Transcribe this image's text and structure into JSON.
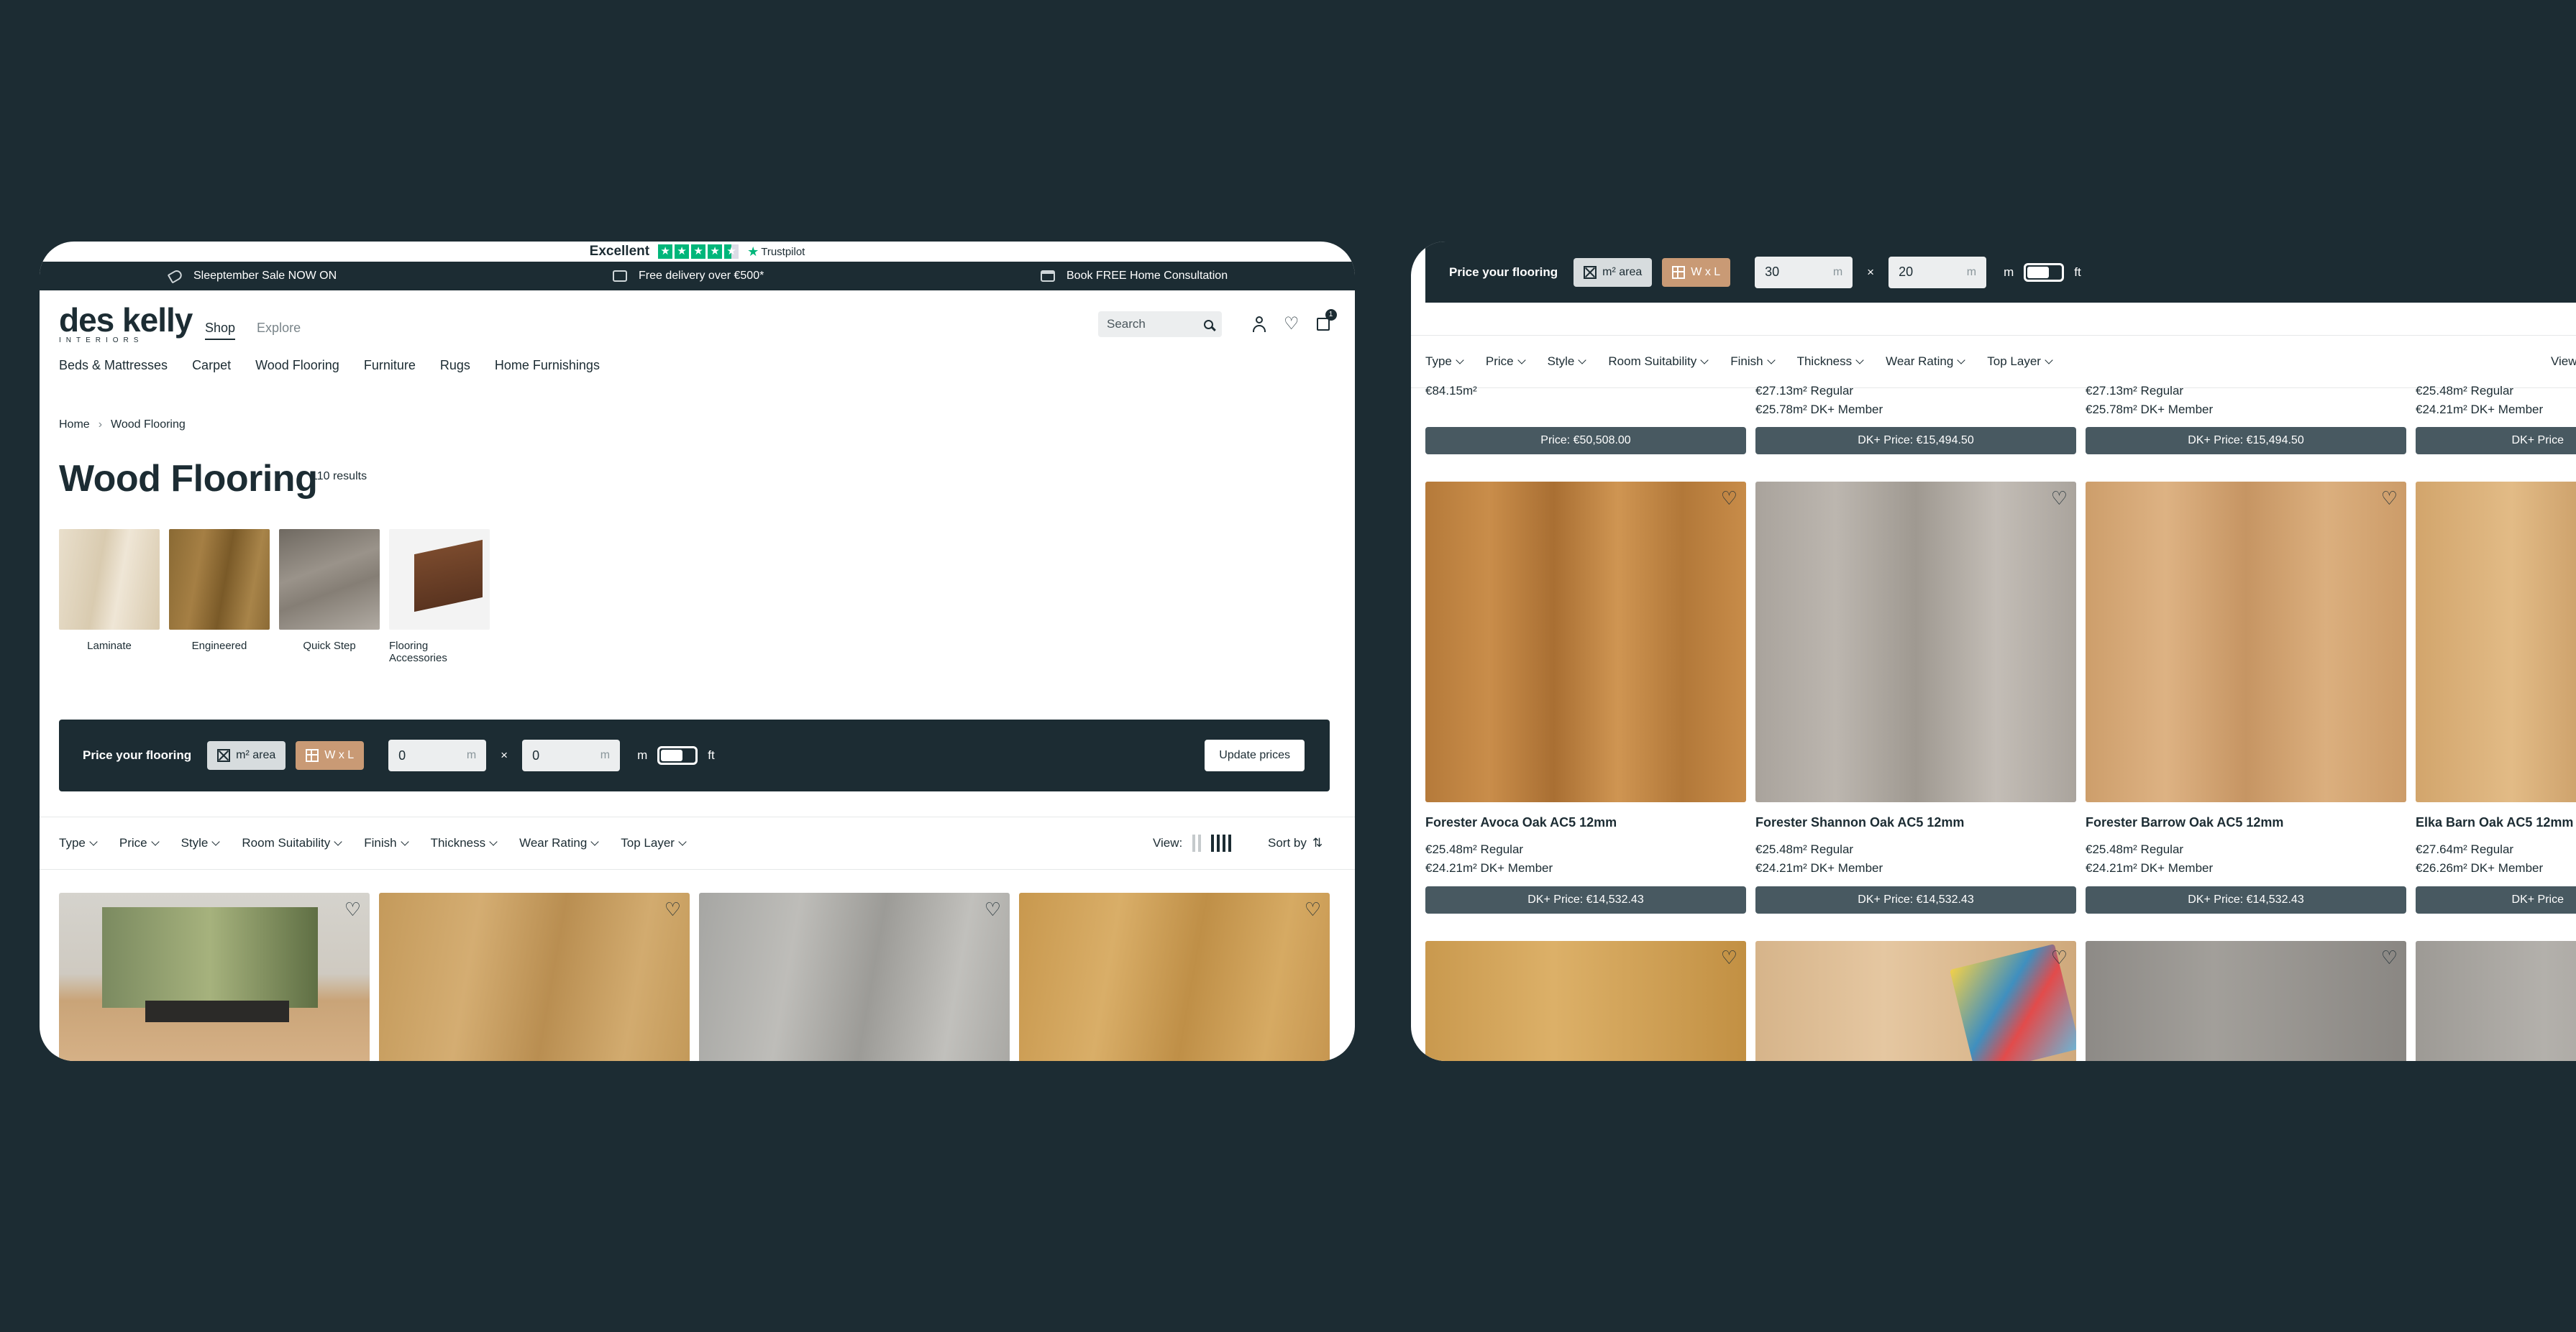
{
  "left": {
    "trustpilot": {
      "rating_word": "Excellent",
      "brand": "Trustpilot"
    },
    "promos": [
      {
        "text": "Sleeptember Sale NOW ON",
        "icon": "tag-icon"
      },
      {
        "text": "Free delivery over €500*",
        "icon": "truck-icon"
      },
      {
        "text": "Book FREE Home Consultation",
        "icon": "calendar-icon"
      }
    ],
    "logo": {
      "main": "des kelly",
      "sub": "INTERIORS"
    },
    "tabs": {
      "shop": "Shop",
      "explore": "Explore"
    },
    "search": {
      "placeholder": "Search"
    },
    "cart_count": "1",
    "categories": [
      "Beds & Mattresses",
      "Carpet",
      "Wood Flooring",
      "Furniture",
      "Rugs",
      "Home Furnishings"
    ],
    "breadcrumb": {
      "home": "Home",
      "sep": "›",
      "current": "Wood Flooring"
    },
    "page_title": "Wood Flooring",
    "results": "110 results",
    "subcategories": [
      "Laminate",
      "Engineered",
      "Quick Step",
      "Flooring Accessories"
    ],
    "price_bar": {
      "title": "Price your flooring",
      "area_label": "m² area",
      "wl_label": "W x L",
      "width": "0",
      "length": "0",
      "unit": "m",
      "times": "×",
      "unit_m": "m",
      "unit_ft": "ft",
      "update": "Update prices"
    },
    "filters": [
      "Type",
      "Price",
      "Style",
      "Room Suitability",
      "Finish",
      "Thickness",
      "Wear Rating",
      "Top Layer"
    ],
    "view_label": "View:",
    "sort_label": "Sort by",
    "sort_icon": "sort-icon"
  },
  "right": {
    "price_bar": {
      "title": "Price your flooring",
      "area_label": "m² area",
      "wl_label": "W x L",
      "width": "30",
      "length": "20",
      "unit": "m",
      "times": "×",
      "unit_m": "m",
      "unit_ft": "ft"
    },
    "filters": [
      "Type",
      "Price",
      "Style",
      "Room Suitability",
      "Finish",
      "Thickness",
      "Wear Rating",
      "Top Layer"
    ],
    "view_label": "View",
    "row0": [
      {
        "line1": "€84.15m²",
        "line2": "",
        "btn": "Price: €50,508.00"
      },
      {
        "line1": "€27.13m² Regular",
        "line2": "€25.78m² DK+ Member",
        "btn": "DK+ Price: €15,494.50"
      },
      {
        "line1": "€27.13m² Regular",
        "line2": "€25.78m² DK+ Member",
        "btn": "DK+ Price: €15,494.50"
      },
      {
        "line1": "€25.48m² Regular",
        "line2": "€24.21m² DK+ Member",
        "btn": "DK+ Price"
      }
    ],
    "row1": [
      {
        "title": "Forester Avoca Oak AC5 12mm",
        "line1": "€25.48m² Regular",
        "line2": "€24.21m² DK+ Member",
        "btn": "DK+ Price: €14,532.43"
      },
      {
        "title": "Forester Shannon Oak AC5 12mm",
        "line1": "€25.48m² Regular",
        "line2": "€24.21m² DK+ Member",
        "btn": "DK+ Price: €14,532.43"
      },
      {
        "title": "Forester Barrow Oak AC5 12mm",
        "line1": "€25.48m² Regular",
        "line2": "€24.21m² DK+ Member",
        "btn": "DK+ Price: €14,532.43"
      },
      {
        "title": "Elka Barn Oak AC5 12mm",
        "line1": "€27.64m² Regular",
        "line2": "€26.26m² DK+ Member",
        "btn": "DK+ Price"
      }
    ]
  }
}
